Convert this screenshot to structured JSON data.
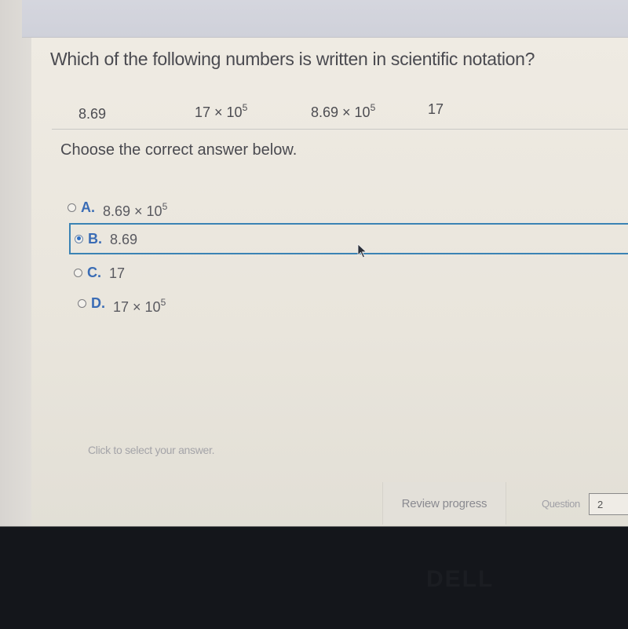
{
  "question": {
    "text": "Which of the following numbers is written in scientific notation?",
    "numbers": [
      {
        "base": "8.69",
        "exponent": ""
      },
      {
        "base": "17 × 10",
        "exponent": "5"
      },
      {
        "base": "8.69 × 10",
        "exponent": "5"
      },
      {
        "base": "17",
        "exponent": ""
      }
    ]
  },
  "instruction": "Choose the correct answer below.",
  "options": [
    {
      "letter": "A.",
      "value": "8.69 × 10",
      "exponent": "5",
      "selected": false
    },
    {
      "letter": "B.",
      "value": "8.69",
      "exponent": "",
      "selected": true
    },
    {
      "letter": "C.",
      "value": "17",
      "exponent": "",
      "selected": false
    },
    {
      "letter": "D.",
      "value": "17 × 10",
      "exponent": "5",
      "selected": false
    }
  ],
  "hint": "Click to select your answer.",
  "footer": {
    "review_label": "Review progress",
    "question_label": "Question",
    "question_number": "2"
  },
  "bezel": {
    "logo": "DELL"
  },
  "colors": {
    "accent": "#3a6cb5",
    "selected_border": "#3b83b4"
  }
}
